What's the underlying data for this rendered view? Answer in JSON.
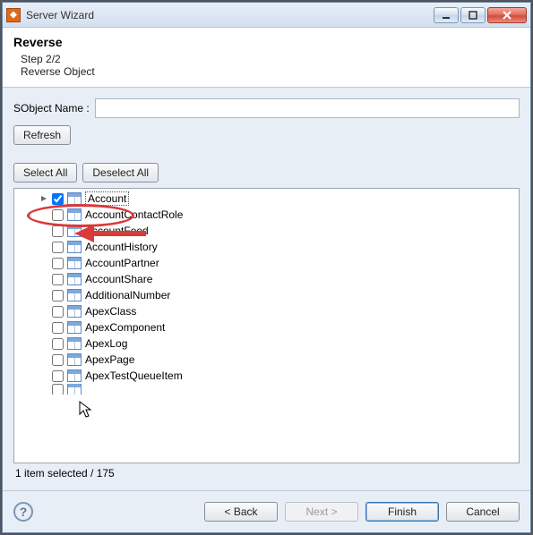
{
  "window": {
    "title": "Server Wizard"
  },
  "header": {
    "heading": "Reverse",
    "step": "Step 2/2",
    "subtitle": "Reverse Object"
  },
  "fields": {
    "sobject_label": "SObject Name :",
    "sobject_value": ""
  },
  "buttons": {
    "refresh": "Refresh",
    "select_all": "Select All",
    "deselect_all": "Deselect All",
    "back": "< Back",
    "next": "Next >",
    "finish": "Finish",
    "cancel": "Cancel"
  },
  "list": {
    "items": [
      {
        "label": "Account",
        "checked": true,
        "selected": true
      },
      {
        "label": "AccountContactRole",
        "checked": false
      },
      {
        "label": "AccountFeed",
        "checked": false
      },
      {
        "label": "AccountHistory",
        "checked": false
      },
      {
        "label": "AccountPartner",
        "checked": false
      },
      {
        "label": "AccountShare",
        "checked": false
      },
      {
        "label": "AdditionalNumber",
        "checked": false
      },
      {
        "label": "ApexClass",
        "checked": false
      },
      {
        "label": "ApexComponent",
        "checked": false
      },
      {
        "label": "ApexLog",
        "checked": false
      },
      {
        "label": "ApexPage",
        "checked": false
      },
      {
        "label": "ApexTestQueueItem",
        "checked": false
      }
    ]
  },
  "status": "1 item selected / 175",
  "help_glyph": "?"
}
